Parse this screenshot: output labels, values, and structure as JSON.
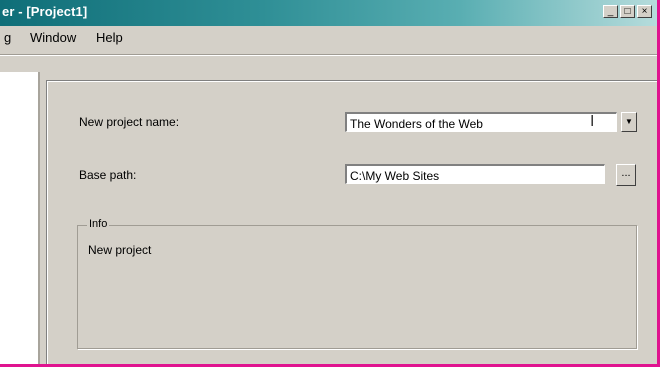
{
  "window": {
    "title": "er - [Project1]",
    "buttons": {
      "minimize": "_",
      "maximize": "□",
      "close": "×"
    }
  },
  "menu": {
    "items": [
      "g",
      "Window",
      "Help"
    ]
  },
  "form": {
    "project_name_label": "New project name:",
    "project_name_value": "The Wonders of the Web",
    "base_path_label": "Base path:",
    "base_path_value": "C:\\My Web Sites",
    "browse_label": "...",
    "combo_arrow": "▼",
    "cursor": "I"
  },
  "info": {
    "legend": "Info",
    "text": "New project"
  }
}
